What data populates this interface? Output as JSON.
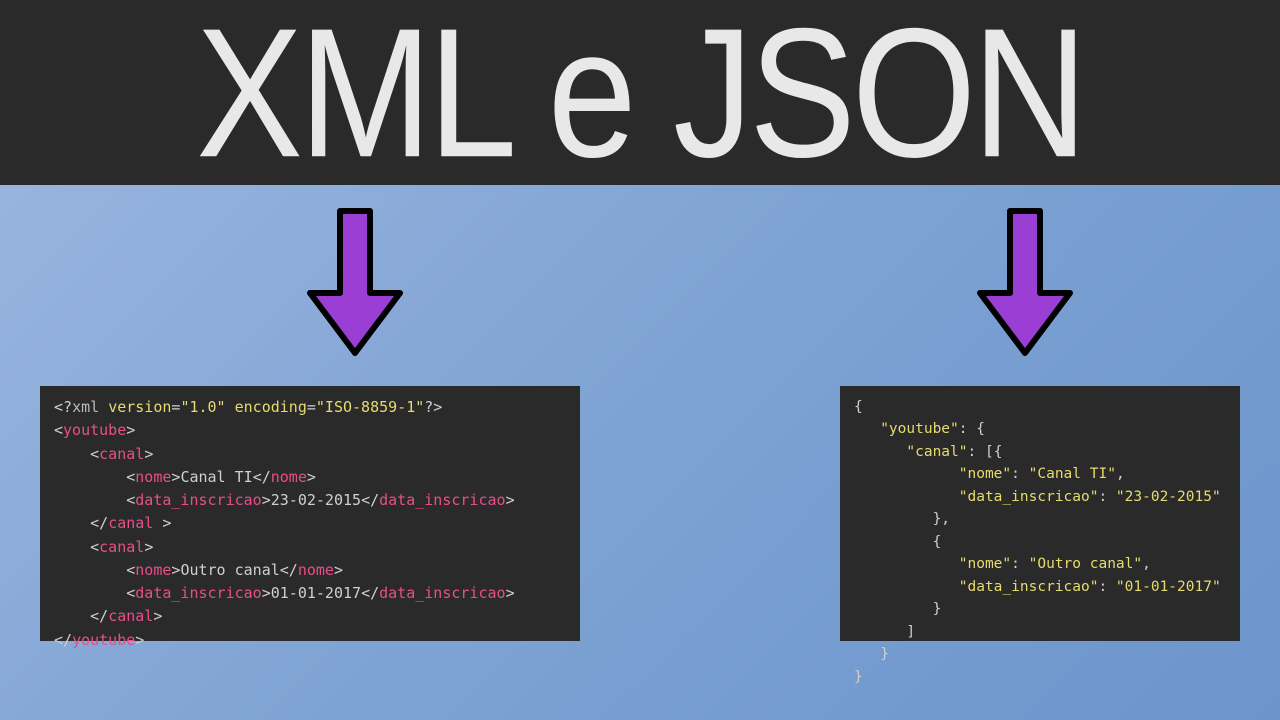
{
  "header": {
    "title": "XML e JSON"
  },
  "xml": {
    "decl_name": "xml",
    "decl_version_attr": "version",
    "decl_version_val": "\"1.0\"",
    "decl_encoding_attr": "encoding",
    "decl_encoding_val": "\"ISO-8859-1\"",
    "root": "youtube",
    "canal_tag": "canal",
    "nome_tag": "nome",
    "data_tag": "data_inscricao",
    "item1_nome": "Canal TI",
    "item1_data": "23-02-2015",
    "item2_nome": "Outro canal",
    "item2_data": "01-01-2017"
  },
  "json": {
    "k_youtube": "\"youtube\"",
    "k_canal": "\"canal\"",
    "k_nome": "\"nome\"",
    "k_data": "\"data_inscricao\"",
    "v1_nome": "\"Canal TI\"",
    "v1_data": "\"23-02-2015\"",
    "v2_nome": "\"Outro canal\"",
    "v2_data": "\"01-01-2017\""
  }
}
